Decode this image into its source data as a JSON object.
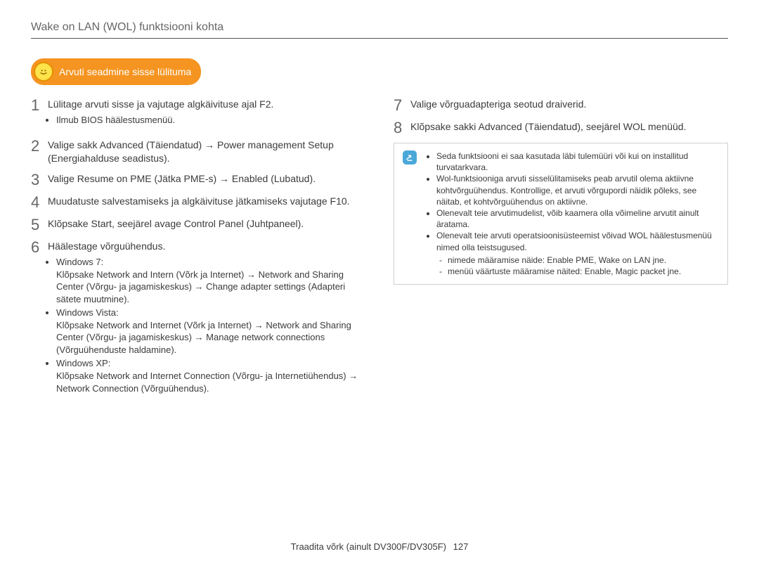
{
  "title": "Wake on LAN (WOL) funktsiooni kohta",
  "section_heading": "Arvuti seadmine sisse lülituma",
  "left": {
    "s1": "Lülitage arvuti sisse ja vajutage algkäivituse ajal F2.",
    "s1_sub": "Ilmub BIOS häälestusmenüü.",
    "s2": "Valige sakk Advanced (Täiendatud) → Power management Setup (Energiahalduse seadistus).",
    "s3": "Valige Resume on PME (Jätka PME-s) → Enabled (Lubatud).",
    "s4": "Muudatuste salvestamiseks ja algkäivituse jätkamiseks vajutage F10.",
    "s5": "Klõpsake Start, seejärel avage Control Panel (Juhtpaneel).",
    "s6": "Häälestage võrguühendus.",
    "s6_a_title": "Windows 7:",
    "s6_a_body": "Klõpsake Network and Intern (Võrk ja Internet) → Network and Sharing Center (Võrgu- ja jagamiskeskus) → Change adapter settings (Adapteri sätete muutmine).",
    "s6_b_title": "Windows Vista:",
    "s6_b_body": "Klõpsake Network and Internet (Võrk ja Internet) → Network and Sharing Center (Võrgu- ja jagamiskeskus) → Manage network connections (Võrguühenduste haldamine).",
    "s6_c_title": "Windows XP:",
    "s6_c_body": "Klõpsake Network and Internet Connection (Võrgu- ja Internetiühendus) → Network Connection (Võrguühendus)."
  },
  "right": {
    "s7": "Valige võrguadapteriga seotud draiverid.",
    "s8": "Klõpsake sakki Advanced (Täiendatud), seejärel WOL menüüd.",
    "note1": "Seda funktsiooni ei saa kasutada läbi tulemüüri või kui on installitud turvatarkvara.",
    "note2": "Wol-funktsiooniga arvuti sisselülitamiseks peab arvutil olema aktiivne kohtvõrguühendus. Kontrollige, et arvuti võrgupordi näidik põleks, see näitab, et kohtvõrguühendus on aktiivne.",
    "note3": "Olenevalt teie arvutimudelist, võib kaamera olla võimeline arvutit ainult äratama.",
    "note4": "Olenevalt teie arvuti operatsioonisüsteemist võivad WOL häälestusmenüü nimed olla teistsugused.",
    "note4_d1": "nimede määramise näide: Enable PME, Wake on LAN jne.",
    "note4_d2": "menüü väärtuste määramise näited: Enable, Magic packet jne."
  },
  "footer": "Traadita võrk (ainult DV300F/DV305F)",
  "page_number": "127"
}
